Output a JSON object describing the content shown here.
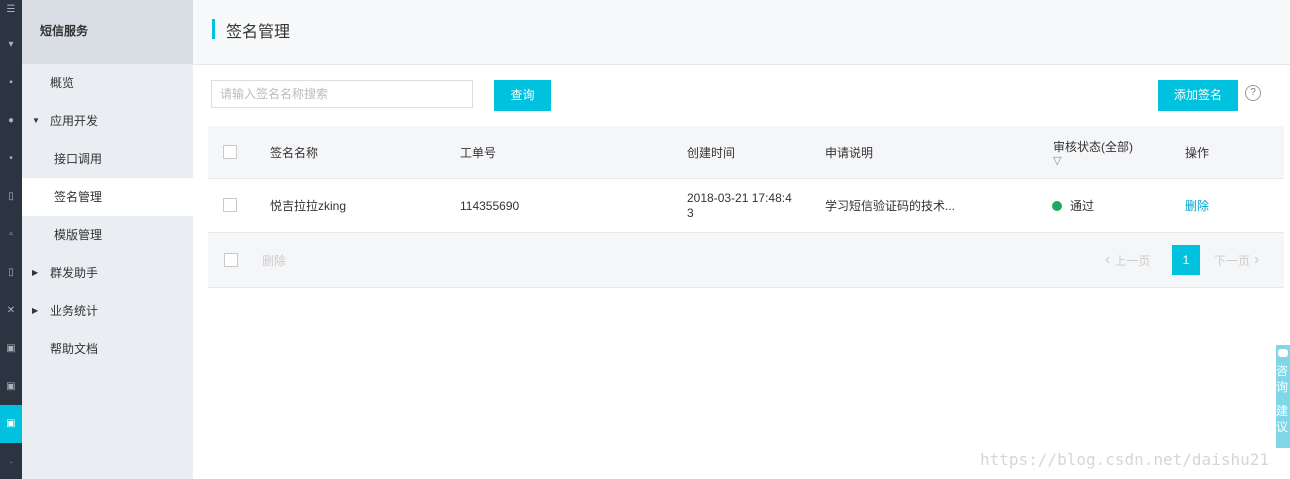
{
  "rail": {
    "icons": [
      "menu-icon",
      "caret-icon",
      "home-icon",
      "pin-icon",
      "dot-icon",
      "doc-icon",
      "mail-icon",
      "list-icon",
      "tool-icon",
      "box-icon",
      "box2-icon",
      "sms-icon",
      "more-icon"
    ]
  },
  "sidebar": {
    "title": "短信服务",
    "items": [
      {
        "label": "概览"
      },
      {
        "label": "应用开发"
      },
      {
        "label": "接口调用"
      },
      {
        "label": "签名管理"
      },
      {
        "label": "模版管理"
      },
      {
        "label": "群发助手"
      },
      {
        "label": "业务统计"
      },
      {
        "label": "帮助文档"
      }
    ]
  },
  "header": {
    "title": "签名管理"
  },
  "toolbar": {
    "search_placeholder": "请输入签名名称搜索",
    "query_label": "查询",
    "add_label": "添加签名",
    "help_label": "?"
  },
  "table": {
    "columns": [
      "签名名称",
      "工单号",
      "创建时间",
      "申请说明",
      "审核状态(全部)",
      "操作"
    ],
    "rows": [
      {
        "name": "悦吉拉拉zking",
        "ticket": "114355690",
        "created_line1": "2018-03-21 17:48:4",
        "created_line2": "3",
        "desc": "学习短信验证码的技术...",
        "status": "通过",
        "action": "删除",
        "status_color": "#1ea95f"
      }
    ],
    "footer": {
      "delete_label": "删除",
      "prev_label": "上一页",
      "page": "1",
      "next_label": "下一页"
    }
  },
  "float_widget": {
    "label1": "咨询",
    "label2": "建议"
  },
  "watermark": "https://blog.csdn.net/daishu21",
  "colors": {
    "accent": "#00c1de",
    "success": "#1ea95f",
    "link": "#00a2ca"
  }
}
